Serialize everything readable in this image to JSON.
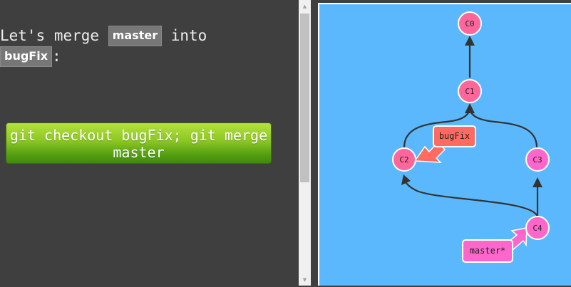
{
  "instruction": {
    "before": "Let's merge ",
    "code1": "master",
    "middle": " into",
    "code2": "bugFix",
    "after": ":"
  },
  "command_button": {
    "label": "git checkout bugFix; git merge master"
  },
  "graph": {
    "commits": [
      {
        "id": "C0",
        "label": "C0",
        "color": "#ff6699"
      },
      {
        "id": "C1",
        "label": "C1",
        "color": "#ff6699"
      },
      {
        "id": "C2",
        "label": "C2",
        "color": "#ff6699"
      },
      {
        "id": "C3",
        "label": "C3",
        "color": "#ff66cc"
      },
      {
        "id": "C4",
        "label": "C4",
        "color": "#ff66cc"
      }
    ],
    "branches": [
      {
        "name": "bugFix",
        "label": "bugFix",
        "target": "C2",
        "color": "#ff6b61"
      },
      {
        "name": "master",
        "label": "master*",
        "target": "C4",
        "color": "#ff66cc"
      }
    ]
  }
}
